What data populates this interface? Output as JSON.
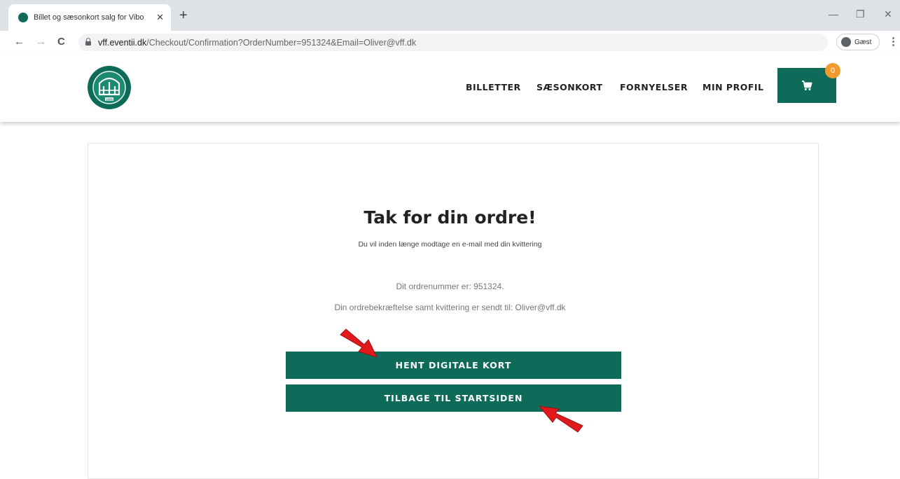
{
  "browser": {
    "tab_title": "Billet og sæsonkort salg for Vibo",
    "tab_close": "✕",
    "new_tab": "+",
    "url_host": "vff.eventii.dk",
    "url_path": "/Checkout/Confirmation?OrderNumber=951324&Email=Oliver@vff.dk",
    "profile_label": "Gæst",
    "back": "←",
    "forward": "→",
    "reload": "C",
    "menu": "⋮",
    "minimize": "—",
    "maximize": "❐",
    "close": "✕"
  },
  "header": {
    "logo_text": "1896",
    "nav": [
      "BILLETTER",
      "SÆSONKORT",
      "FORNYELSER",
      "MIN PROFIL"
    ],
    "cart_count": "0"
  },
  "confirmation": {
    "heading": "Tak for din ordre!",
    "subtext": "Du vil inden længe modtage en e-mail med din kvittering",
    "order_number_text": "Dit ordrenummer er: 951324.",
    "receipt_text": "Din ordrebekræftelse samt kvittering er sendt til: Oliver@vff.dk",
    "primary_button": "HENT DIGITALE KORT",
    "secondary_button": "TILBAGE TIL STARTSIDEN"
  },
  "colors": {
    "brand_green": "#0e6b5a",
    "cart_badge": "#f29a2e",
    "annotation_arrow": "#e0191c"
  }
}
